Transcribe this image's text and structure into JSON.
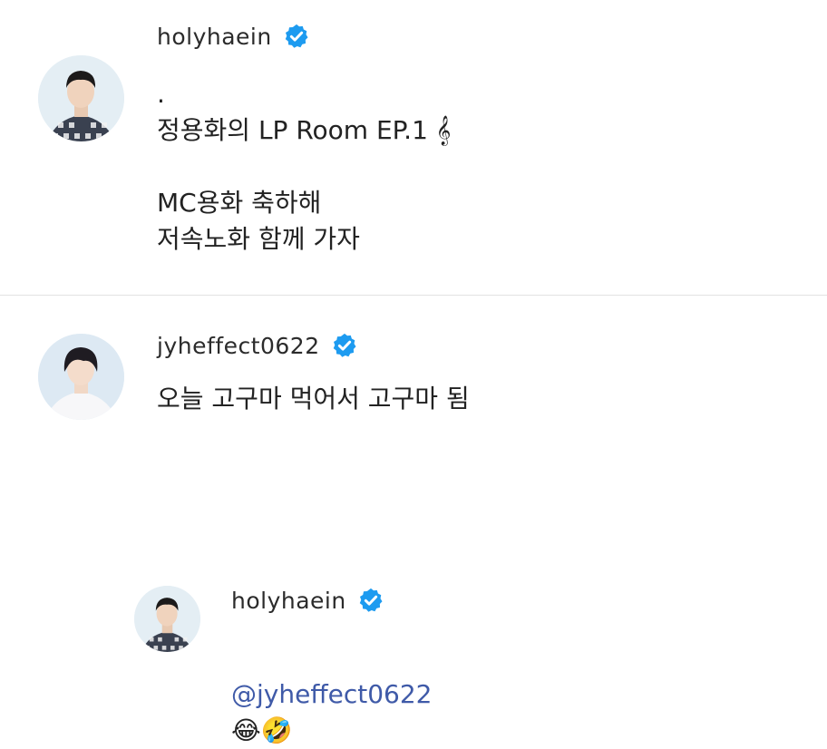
{
  "posts": [
    {
      "username": "holyhaein",
      "verified": true,
      "lines": [
        ".",
        "정용화의 LP Room EP.1 𝄞",
        "",
        "MC용화 축하해",
        "저속노화 함께 가자"
      ],
      "text": ".\n정용화의 LP Room EP.1 𝄞\n\nMC용화 축하해\n저속노화 함께 가자"
    },
    {
      "username": "jyheffect0622",
      "verified": true,
      "text": "오늘 고구마 먹어서 고구마 됨"
    }
  ],
  "reply": {
    "username": "holyhaein",
    "verified": true,
    "mention": "@jyheffect0622",
    "emojis": "😂🤣"
  },
  "colors": {
    "verified_badge": "#1d9bf0",
    "mention": "#3f5aa8",
    "divider": "#e2e2e2"
  },
  "icons": {
    "verified": "verified-badge-icon",
    "treble_clef": "treble-clef-emoji"
  }
}
